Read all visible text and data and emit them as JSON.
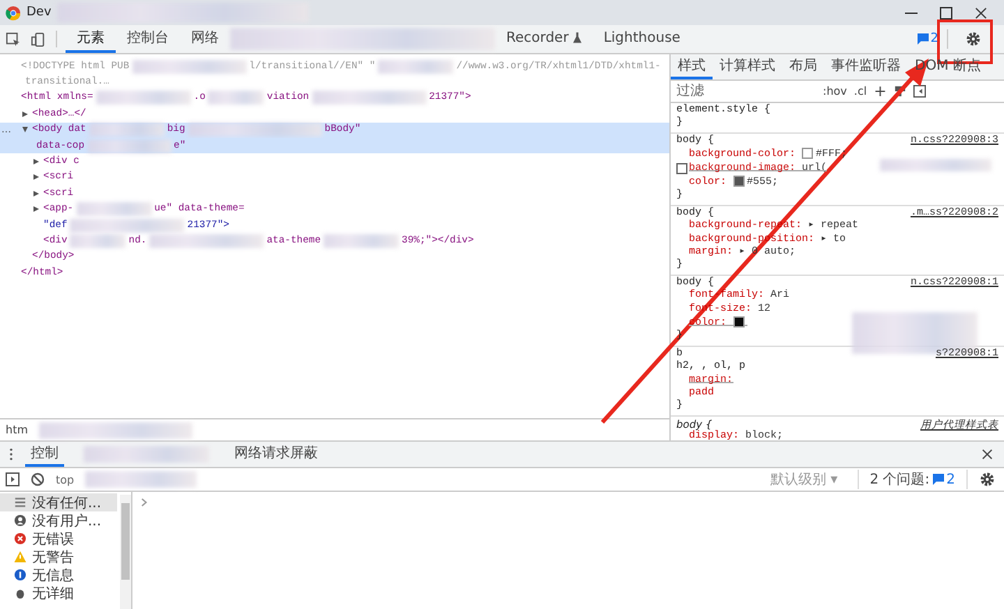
{
  "window": {
    "title": "Dev"
  },
  "toolbar": {
    "tabs": [
      {
        "label": "元素",
        "selected": true
      },
      {
        "label": "控制台",
        "selected": false
      },
      {
        "label": "网络",
        "selected": false
      },
      {
        "label": "Recorder",
        "selected": false,
        "kind": "recorder"
      },
      {
        "label": "Lighthouse",
        "selected": false
      }
    ],
    "issues_count": "2"
  },
  "elements": [
    {
      "segments": [
        "<!DOCTYPE html PUB",
        "l/transitional//EN\" \"",
        "//www.w3.org/TR/xhtml1/DTD/xhtml1-"
      ],
      "wrap": "transitional.…",
      "kind": "doctype"
    },
    {
      "segments": [
        "<html xmlns=",
        ".o",
        "viation",
        "21377\">"
      ],
      "kind": "tag",
      "children": [
        {
          "segments": [
            "<head>…</"
          ],
          "kind": "tag",
          "expanded": false
        },
        {
          "gutter": "…",
          "segments": [
            "<body dat",
            "big",
            "bBody\""
          ],
          "wrap": "data-cop",
          "wrap_end": "e\"",
          "kind": "tag",
          "expanded": true,
          "selected": true,
          "children": [
            {
              "segments": [
                "<div c"
              ],
              "kind": "tag",
              "expanded": false
            },
            {
              "segments": [
                "<scri"
              ],
              "kind": "tag",
              "expanded": false
            },
            {
              "segments": [
                "<scri"
              ],
              "kind": "tag",
              "expanded": false
            },
            {
              "segments": [
                "<app-",
                "ue\" data-theme="
              ],
              "kind": "tag",
              "expanded": false
            },
            {
              "segments": [
                "\"def",
                "21377\">"
              ],
              "kind": "text"
            },
            {
              "segments": [
                "<div",
                "nd.",
                "ata-theme",
                "39%;\"></div>"
              ],
              "kind": "tag"
            }
          ]
        },
        {
          "segments": [
            "</body>"
          ],
          "kind": "tag"
        }
      ]
    },
    {
      "segments": [
        "</html>"
      ],
      "kind": "tag"
    }
  ],
  "breadcrumb": "htm",
  "styles": {
    "tabs": [
      {
        "label": "样式",
        "selected": true
      },
      {
        "label": "计算样式",
        "selected": false
      },
      {
        "label": "布局",
        "selected": false
      },
      {
        "label": "事件监听器",
        "selected": false
      },
      {
        "label": "DOM 断点",
        "selected": false
      }
    ],
    "filter": {
      "placeholder": "过滤"
    },
    "hov": ":hov",
    "cls": ".cl",
    "plus": "+",
    "rules": [
      {
        "selector": "element.style {",
        "close": "}"
      },
      {
        "selector": "body {",
        "source": "n.css?220908:3",
        "close": "}",
        "declarations": [
          {
            "prop": "background-color:",
            "value": "#FFF;",
            "color": "#ffffff",
            "struck": false
          },
          {
            "prop": "background-image:",
            "value": "url(",
            "struck": true,
            "checked": false
          },
          {
            "prop": "color:",
            "value": "#555;",
            "color": "#555555",
            "struck": false
          }
        ]
      },
      {
        "selector": "body {",
        "source": ".m…ss?220908:2",
        "close": "}",
        "declarations": [
          {
            "prop": "background-repeat:",
            "value": "▸ repeat",
            "struck": false
          },
          {
            "prop": "background-position:",
            "value": "▸ to",
            "struck": false
          },
          {
            "prop": "margin:",
            "value": "▸ 0 auto;",
            "struck": false
          }
        ]
      },
      {
        "selector": "body {",
        "source": "n.css?220908:1",
        "close": "}",
        "declarations": [
          {
            "prop": "font-family:",
            "value": "Ari",
            "struck": false
          },
          {
            "prop": "font-size:",
            "value": "12",
            "struck": false
          },
          {
            "prop": "color:",
            "color": "#000000",
            "struck": true
          }
        ]
      },
      {
        "selector": "b",
        "selector2": "h2, , ol, p",
        "source": "s?220908:1",
        "close": "}",
        "declarations": [
          {
            "prop": "margin:",
            "struck": true
          },
          {
            "prop": "padd",
            "struck": false
          }
        ]
      },
      {
        "selector": "body {",
        "source": "用户代理样式表",
        "ua": true,
        "declarations": [
          {
            "prop": "display:",
            "value": "block;",
            "struck": false
          }
        ]
      }
    ]
  },
  "drawer": {
    "tabs": [
      {
        "label": "控制",
        "selected": true
      },
      {
        "label": "网络请求屏蔽",
        "selected": false
      }
    ],
    "context": "top",
    "level": "默认级别 ▾",
    "issues": "2 个问题:",
    "issues_count": "2",
    "sidebar": [
      {
        "label": "没有任何...",
        "kind": "messages",
        "selected": true
      },
      {
        "label": "没有用户...",
        "kind": "user",
        "selected": false
      },
      {
        "label": "无错误",
        "kind": "error",
        "selected": false
      },
      {
        "label": "无警告",
        "kind": "warning",
        "selected": false
      },
      {
        "label": "无信息",
        "kind": "info",
        "selected": false
      },
      {
        "label": "无详细",
        "kind": "verbose",
        "selected": false
      }
    ]
  }
}
